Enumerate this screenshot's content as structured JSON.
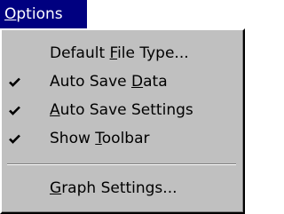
{
  "menu": {
    "title_mnemonic": "O",
    "title_rest": "ptions",
    "items": [
      {
        "pre": "Default ",
        "mnemonic": "F",
        "post": "ile Type...",
        "checked": false
      },
      {
        "pre": "Auto Save ",
        "mnemonic": "D",
        "post": "ata",
        "checked": true
      },
      {
        "pre": "",
        "mnemonic": "A",
        "post": "uto Save Settings",
        "checked": true
      },
      {
        "pre": "Show ",
        "mnemonic": "T",
        "post": "oolbar",
        "checked": true
      },
      {
        "pre": "",
        "mnemonic": "G",
        "post": "raph Settings...",
        "checked": false
      }
    ]
  },
  "icons": {
    "check": "checkmark-icon"
  },
  "colors": {
    "menu_face": "#c0c0c0",
    "highlight": "#000080",
    "highlight_text": "#ffffff",
    "text": "#000000"
  }
}
